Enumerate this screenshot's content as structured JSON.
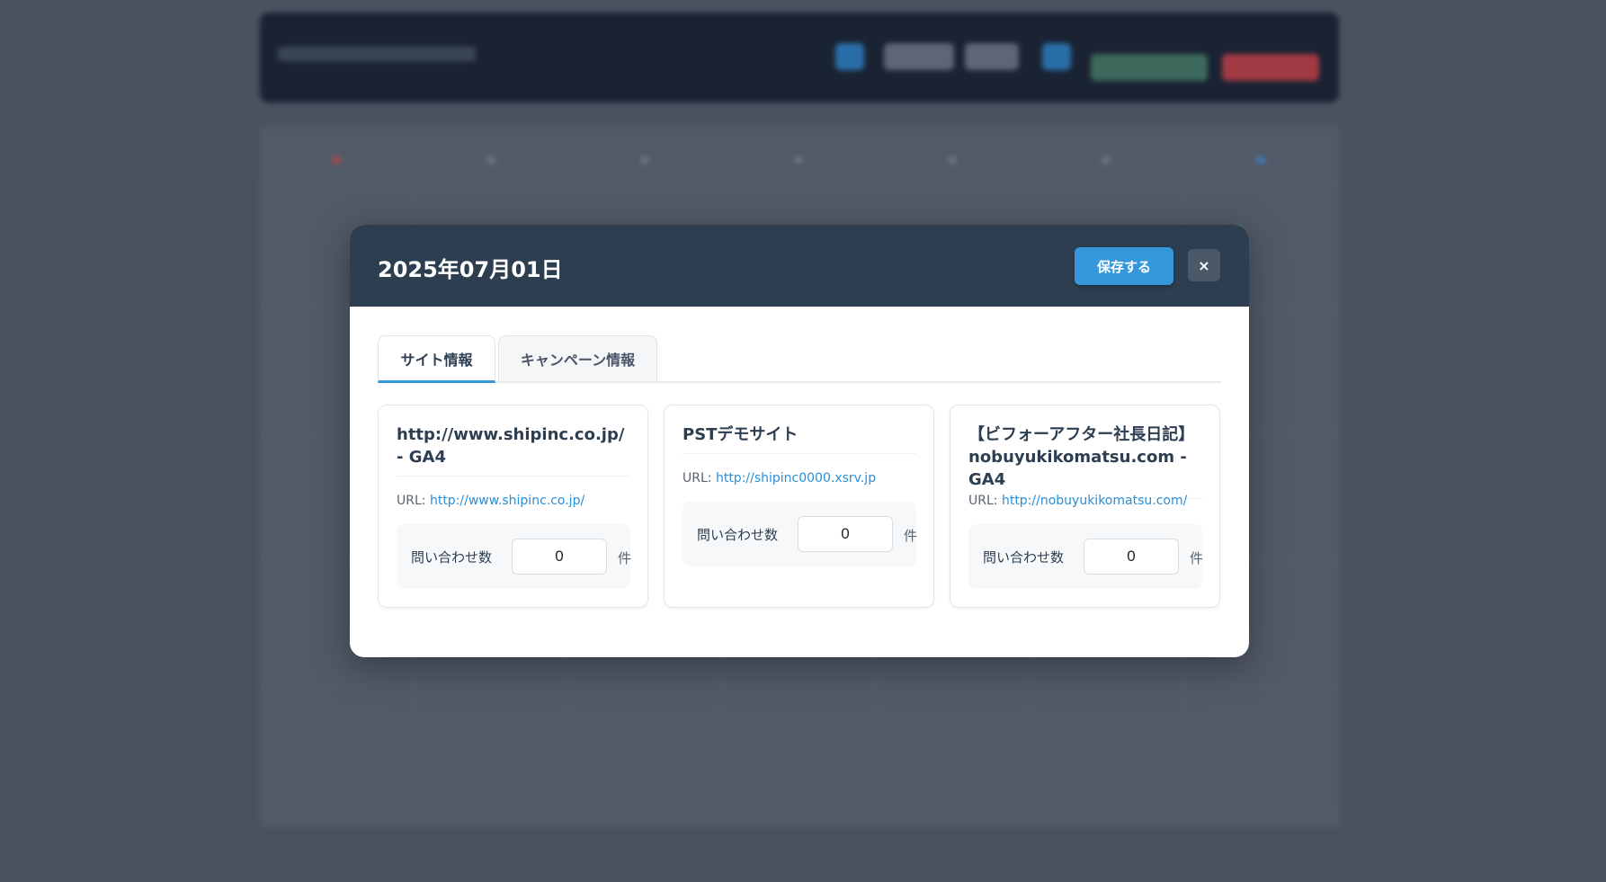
{
  "modal": {
    "title": "2025年07月01日",
    "save_label": "保存する",
    "close_label": "×"
  },
  "tabs": [
    {
      "label": "サイト情報",
      "active": true
    },
    {
      "label": "キャンペーン情報",
      "active": false
    }
  ],
  "sites": [
    {
      "title": "http://www.shipinc.co.jp/ - GA4",
      "url_label": "URL:",
      "url": "http://www.shipinc.co.jp/",
      "count_label": "問い合わせ数",
      "count_value": "0",
      "unit": "件"
    },
    {
      "title": "PSTデモサイト",
      "url_label": "URL:",
      "url": "http://shipinc0000.xsrv.jp",
      "count_label": "問い合わせ数",
      "count_value": "0",
      "unit": "件"
    },
    {
      "title": "【ビフォーアフター社長日記】nobuyukikomatsu.com - GA4",
      "url_label": "URL:",
      "url": "http://nobuyukikomatsu.com/",
      "count_label": "問い合わせ数",
      "count_value": "0",
      "unit": "件"
    }
  ],
  "colors": {
    "header_bg": "#2c3e50",
    "accent": "#3498db",
    "link": "#2b8fd6"
  }
}
